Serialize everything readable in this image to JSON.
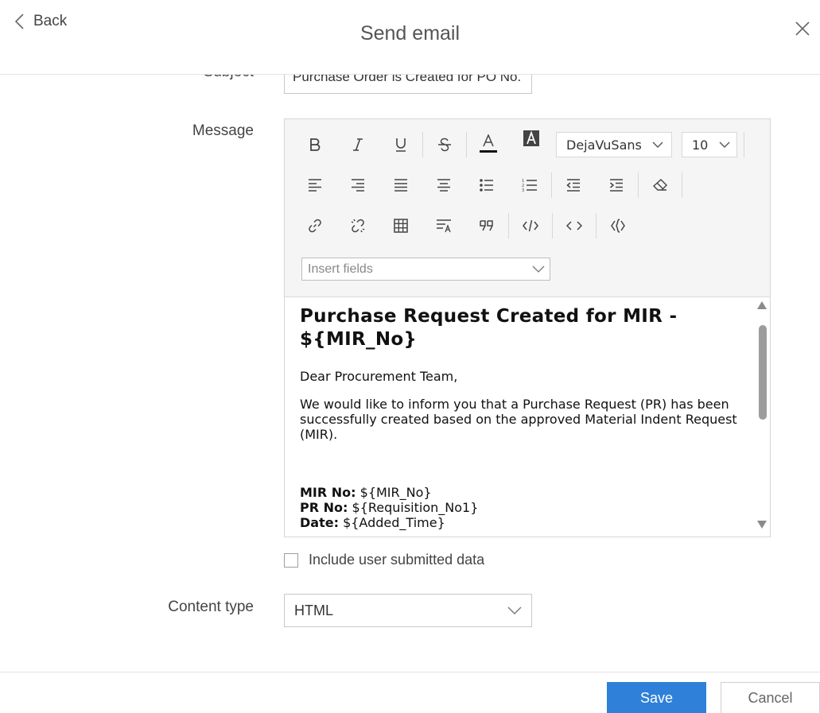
{
  "header": {
    "back_label": "Back",
    "title": "Send email"
  },
  "form": {
    "subject_label": "Subject",
    "subject_value": "Purchase Order is Created for PO No.",
    "message_label": "Message",
    "content_type_label": "Content type",
    "content_type_value": "HTML",
    "include_label": "Include user submitted data",
    "include_checked": false
  },
  "toolbar": {
    "font_family": "DejaVuSans",
    "font_size": "10",
    "insert_fields_placeholder": "Insert fields",
    "icons": [
      "bold-icon",
      "italic-icon",
      "underline-icon",
      "strikethrough-icon",
      "font-color-icon",
      "background-color-icon",
      "align-left-icon",
      "align-right-icon",
      "align-justify-icon",
      "align-center-icon",
      "bullet-list-icon",
      "numbered-list-icon",
      "outdent-icon",
      "indent-icon",
      "clear-format-icon",
      "link-icon",
      "unlink-icon",
      "table-icon",
      "line-height-icon",
      "blockquote-icon",
      "code-icon",
      "html-source-icon",
      "insert-field-icon"
    ]
  },
  "message": {
    "heading": "Purchase Request Created for MIR - ${MIR_No}",
    "greeting": "Dear Procurement Team,",
    "body": "We would like to inform you that a Purchase Request (PR) has been successfully created based on the approved Material Indent Request (MIR).",
    "fields": [
      {
        "key": "MIR No:",
        "value": " ${MIR_No}"
      },
      {
        "key": "PR No:",
        "value": " ${Requisition_No1}"
      },
      {
        "key": "Date:",
        "value": " ${Added_Time}"
      }
    ]
  },
  "footer": {
    "save_label": "Save",
    "cancel_label": "Cancel"
  },
  "colors": {
    "primary": "#2f80d8"
  }
}
